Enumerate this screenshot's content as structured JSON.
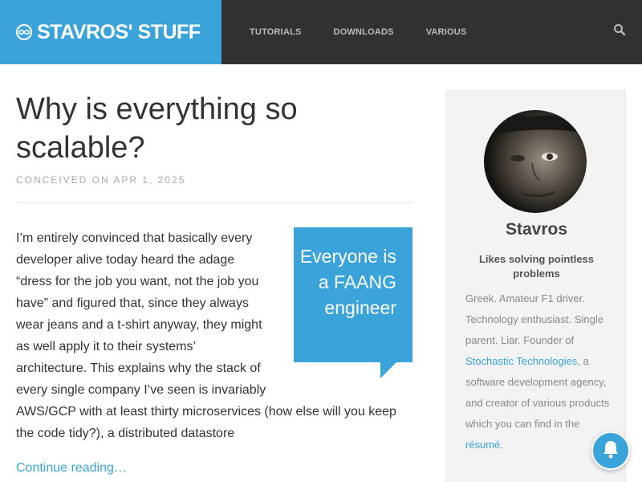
{
  "site": {
    "title": "STAVROS' STUFF",
    "logo_icon": "logo-circle-icon"
  },
  "nav": {
    "items": [
      "TUTORIALS",
      "DOWNLOADS",
      "VARIOUS"
    ],
    "search_icon": "search-icon"
  },
  "post": {
    "title": "Why is everything so scalable?",
    "meta": "CONCEIVED ON APR 1, 2025",
    "pullquote": "Everyone is a FAANG engineer",
    "excerpt": "I’m entirely convinced that basically every developer alive today heard the adage “dress for the job you want, not the job you have” and figured that, since they always wear jeans and a t-shirt anyway, they might as well apply it to their systems’ architecture. This explains why the stack of every single company I’ve seen is invariably AWS/GCP with at least thirty microservices (how else will you keep the code tidy?), a distributed datastore",
    "read_more": "Continue reading…"
  },
  "sidebar": {
    "name": "Stavros",
    "tagline": "Likes solving pointless problems",
    "bio_prefix": "Greek. Amateur F1 driver. Technology enthusiast. Single parent. Liar. Founder of ",
    "bio_link1": "Stochastic Technologies",
    "bio_middle": ", a software development agency, and creator of various products which you can find in the ",
    "bio_link2": "résumé",
    "bio_suffix": "."
  },
  "notification": {
    "icon": "bell-icon"
  },
  "colors": {
    "accent": "#3aa3da",
    "topbar": "#2f3133",
    "sidebar_bg": "#f3f3f3"
  }
}
